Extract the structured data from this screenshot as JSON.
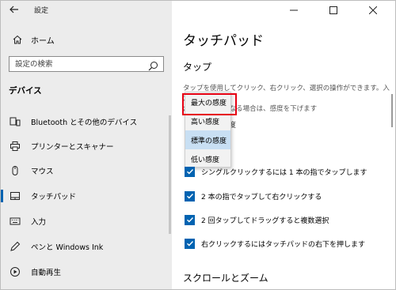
{
  "window": {
    "title": "設定",
    "back_icon": "back-arrow-icon"
  },
  "sidebar": {
    "home_label": "ホーム",
    "search_placeholder": "設定の検索",
    "section_label": "デバイス",
    "items": [
      {
        "label": "Bluetooth とその他のデバイス",
        "icon": "bluetooth-device-icon"
      },
      {
        "label": "プリンターとスキャナー",
        "icon": "printer-icon"
      },
      {
        "label": "マウス",
        "icon": "mouse-icon"
      },
      {
        "label": "タッチパッド",
        "icon": "touchpad-icon",
        "selected": true
      },
      {
        "label": "入力",
        "icon": "keyboard-icon"
      },
      {
        "label": "ペンと Windows Ink",
        "icon": "pen-icon"
      },
      {
        "label": "自動再生",
        "icon": "autoplay-icon"
      }
    ]
  },
  "main": {
    "title": "タッチパッド",
    "tap_header": "タップ",
    "tap_description_line1": "タップを使用してクリック、右クリック、選択の操作ができます。入力",
    "tap_description_line2": "がアクティブになる場合は、感度を下げます",
    "sensitivity_label_partial": "度",
    "sensitivity_options": [
      "最大の感度",
      "高い感度",
      "標準の感度",
      "低い感度"
    ],
    "selected_option": "標準の感度",
    "checkboxes": [
      {
        "label": "シングルクリックするには 1 本の指でタップします",
        "checked": true
      },
      {
        "label": "2 本の指でタップして右クリックする",
        "checked": true
      },
      {
        "label": "2 回タップしてドラッグすると複数選択",
        "checked": true
      },
      {
        "label": "右クリックするにはタッチパッドの右下を押します",
        "checked": true
      }
    ],
    "scroll_zoom_header": "スクロールとズーム"
  },
  "colors": {
    "accent": "#0063b1",
    "highlight_box": "#e60012",
    "sidebar_bg": "#ececec",
    "dropdown_selected": "#c8dff3"
  }
}
